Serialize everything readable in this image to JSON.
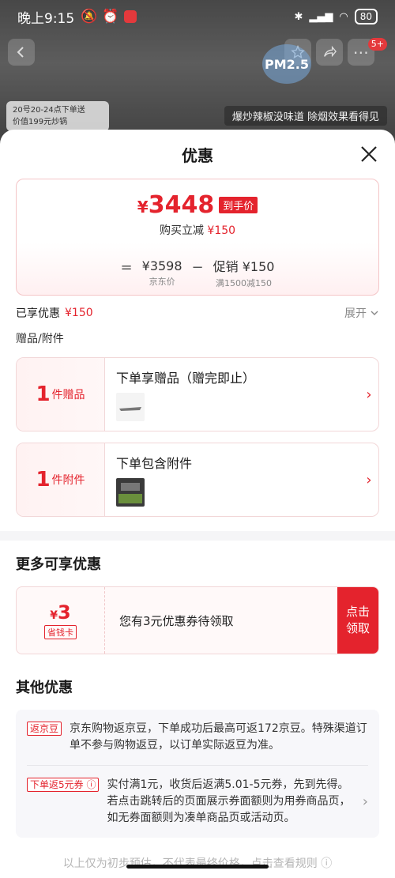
{
  "statusbar": {
    "time": "晚上9:15",
    "battery": "80"
  },
  "background": {
    "pm_badge": "PM2.5",
    "promo_chip_line1": "20号20-24点下单送",
    "promo_chip_line2": "价值199元炒锅",
    "promo_strip": "爆炒辣椒没味道 除烟效果看得见",
    "msg_badge": "5+"
  },
  "sheet": {
    "title": "优惠",
    "price": {
      "final": "3448",
      "final_yen": "¥",
      "final_tag": "到手价",
      "reduce_label": "购买立减",
      "reduce_amount": "¥150"
    },
    "calc": {
      "eq": "=",
      "jd_price": "¥3598",
      "jd_price_label": "京东价",
      "minus": "−",
      "promo": "促销 ¥150",
      "promo_label": "满1500减150"
    },
    "enjoyed": {
      "label": "已享优惠",
      "amount": "¥150",
      "expand": "展开"
    },
    "gift_section": "赠品/附件",
    "gifts": [
      {
        "count": "1",
        "unit": "件赠品",
        "title": "下单享赠品（赠完即止）"
      },
      {
        "count": "1",
        "unit": "件附件",
        "title": "下单包含附件"
      }
    ],
    "more_title": "更多可享优惠",
    "coupon": {
      "yen": "¥",
      "amount": "3",
      "tag": "省钱卡",
      "text": "您有3元优惠券待领取",
      "btn_line1": "点击",
      "btn_line2": "领取"
    },
    "other_title": "其他优惠",
    "others": [
      {
        "tag": "返京豆",
        "text": "京东购物返京豆，下单成功后最高可返172京豆。特殊渠道订单不参与购物返豆，以订单实际返豆为准。"
      },
      {
        "tag": "下单返5元券 ⓘ",
        "text": "实付满1元，收货后返满5.01-5元券，先到先得。若点击跳转后的页面展示券面额则为用券商品页，如无券面额则为凑单商品页或活动页。"
      }
    ],
    "footer": "以上仅为初步预估，不代表最终价格，点击查看规则 ⓘ"
  }
}
